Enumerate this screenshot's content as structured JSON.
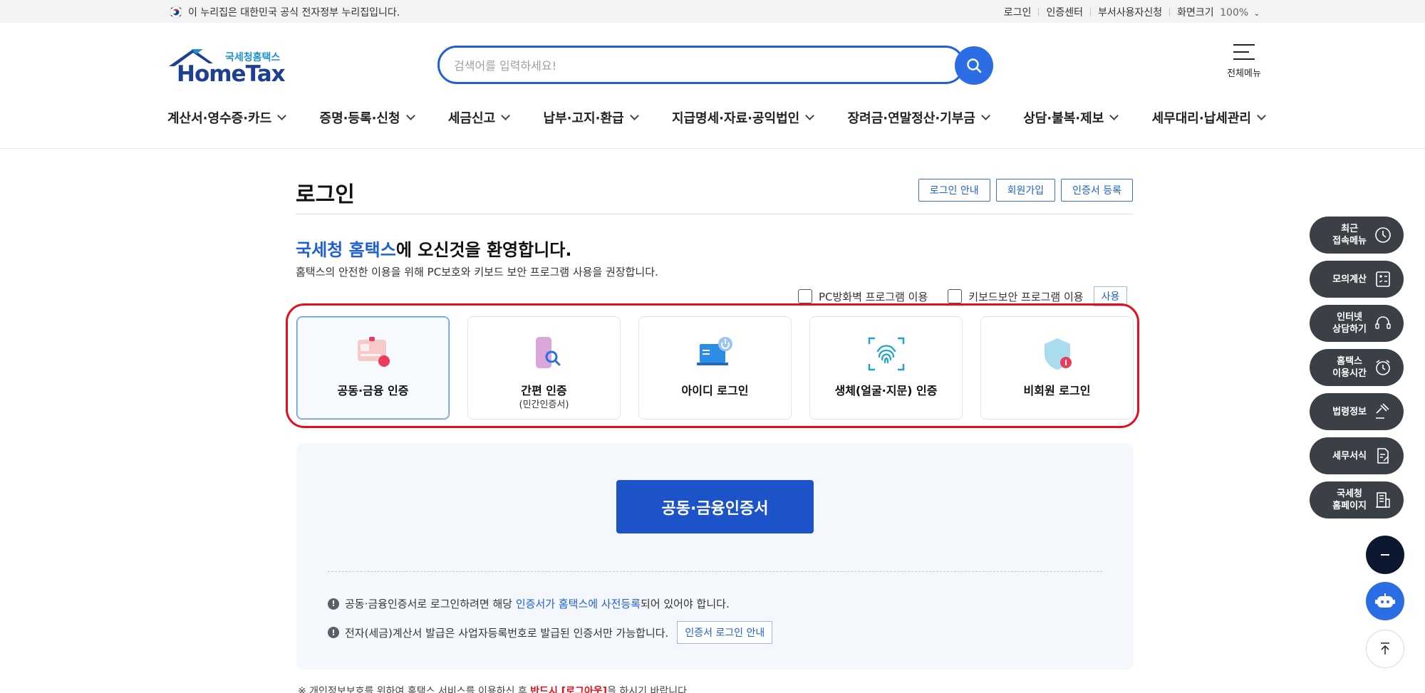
{
  "gov_banner": {
    "text": "이 누리집은 대한민국 공식 전자정부 누리집입니다.",
    "links": [
      "로그인",
      "인증센터",
      "부서사용자신청"
    ],
    "font_size_label": "화면크기",
    "font_size_value": "100%"
  },
  "header": {
    "logo_sub": "국세청홈택스",
    "logo_main": "HomeTax",
    "search_placeholder": "검색어를 입력하세요!",
    "all_menu_label": "전체메뉴"
  },
  "nav": [
    "계산서·영수증·카드",
    "증명·등록·신청",
    "세금신고",
    "납부·고지·환급",
    "지급명세·자료·공익법인",
    "장려금·연말정산·기부금",
    "상담·불복·제보",
    "세무대리·납세관리"
  ],
  "login": {
    "title": "로그인",
    "top_buttons": [
      "로그인 안내",
      "회원가입",
      "인증서 등록"
    ],
    "welcome_highlight": "국세청 홈택스",
    "welcome_rest": "에 오신것을 환영합니다.",
    "notice": "홈택스의 안전한 이용을 위해 PC보호와 키보드 보안 프로그램 사용을 권장합니다.",
    "option_pc_firewall": "PC방화벽 프로그램 이용",
    "option_keyboard": "키보드보안 프로그램 이용",
    "option_use_button": "사용",
    "methods": [
      {
        "label": "공동·금융 인증",
        "sub": ""
      },
      {
        "label": "간편 인증",
        "sub": "(민간인증서)"
      },
      {
        "label": "아이디 로그인",
        "sub": ""
      },
      {
        "label": "생체(얼굴·지문) 인증",
        "sub": ""
      },
      {
        "label": "비회원 로그인",
        "sub": ""
      }
    ],
    "selected_method": "공동·금융 인증",
    "main_button": "공동·금융인증서",
    "info1_pre": "공동·금융인증서로 로그인하려면 해당 ",
    "info1_link": "인증서가 홈택스에 사전등록",
    "info1_post": "되어 있어야 합니다.",
    "info2_text": "전자(세금)계산서 발급은 사업자등록번호로 발급된 인증서만 가능합니다.",
    "info2_button": "인증서 로그인 안내",
    "footnote_pre": "※ 개인정보보호를 위하여 홈택스 서비스를 이용하신 후 ",
    "footnote_red": "반드시 [로그아웃]",
    "footnote_post": "을 하시기 바랍니다."
  },
  "quick_menu": [
    {
      "line1": "최근",
      "line2": "접속메뉴",
      "icon": "clock-icon"
    },
    {
      "line1": "모의계산",
      "line2": "",
      "icon": "calculator-icon"
    },
    {
      "line1": "인터넷",
      "line2": "상담하기",
      "icon": "headset-icon"
    },
    {
      "line1": "홈택스",
      "line2": "이용시간",
      "icon": "alarm-clock-icon"
    },
    {
      "line1": "법령정보",
      "line2": "",
      "icon": "gavel-icon"
    },
    {
      "line1": "세무서식",
      "line2": "",
      "icon": "document-edit-icon"
    },
    {
      "line1": "국세청",
      "line2": "홈페이지",
      "icon": "building-icon"
    }
  ],
  "colors": {
    "primary": "#1f5fd8",
    "button_dark_blue": "#1d53c8",
    "highlight_red": "#e3101c",
    "quick_menu_bg": "#3b3f46"
  }
}
